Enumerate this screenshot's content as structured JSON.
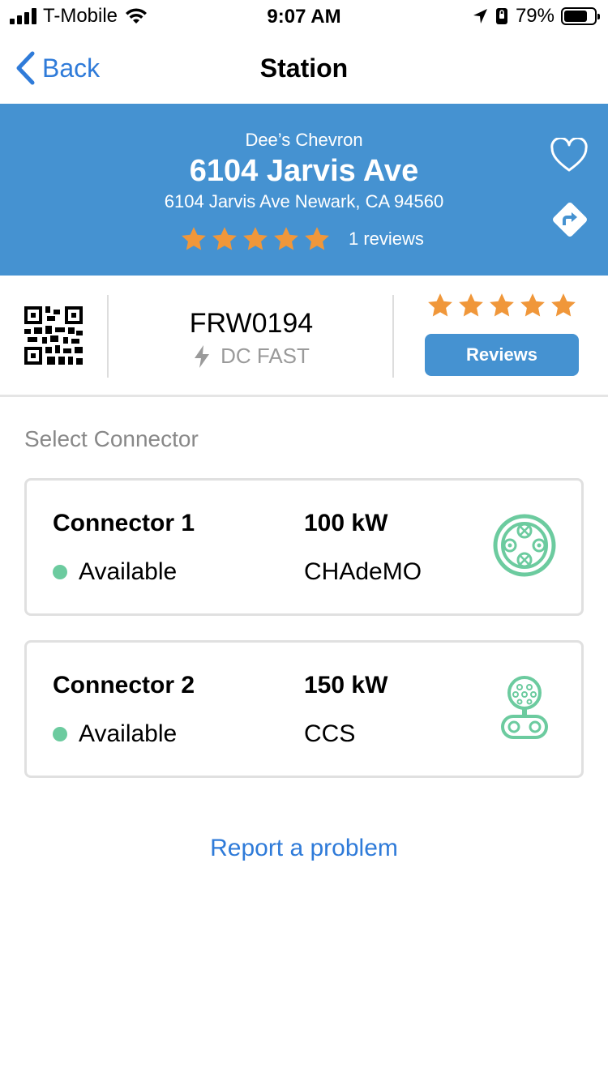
{
  "status_bar": {
    "carrier": "T-Mobile",
    "time": "9:07 AM",
    "battery": "79%",
    "battery_level": 0.79
  },
  "nav": {
    "back_label": "Back",
    "title": "Station"
  },
  "station": {
    "brand": "Dee’s Chevron",
    "name": "6104 Jarvis Ave",
    "address": "6104 Jarvis Ave Newark, CA 94560",
    "rating": 5,
    "reviews_count": "1 reviews",
    "id": "FRW0194",
    "charger_type": "DC FAST",
    "reviews_button": "Reviews"
  },
  "connectors_section": {
    "label": "Select Connector",
    "connectors": [
      {
        "name": "Connector 1",
        "power": "100 kW",
        "status": "Available",
        "type": "CHAdeMO",
        "icon": "chademo-connector-icon"
      },
      {
        "name": "Connector 2",
        "power": "150 kW",
        "status": "Available",
        "type": "CCS",
        "icon": "ccs-connector-icon"
      }
    ]
  },
  "report_link": "Report a problem",
  "colors": {
    "header_blue": "#4592D1",
    "link_blue": "#2F7BD9",
    "star_orange": "#F0973A",
    "available_green": "#6CCB9F"
  }
}
